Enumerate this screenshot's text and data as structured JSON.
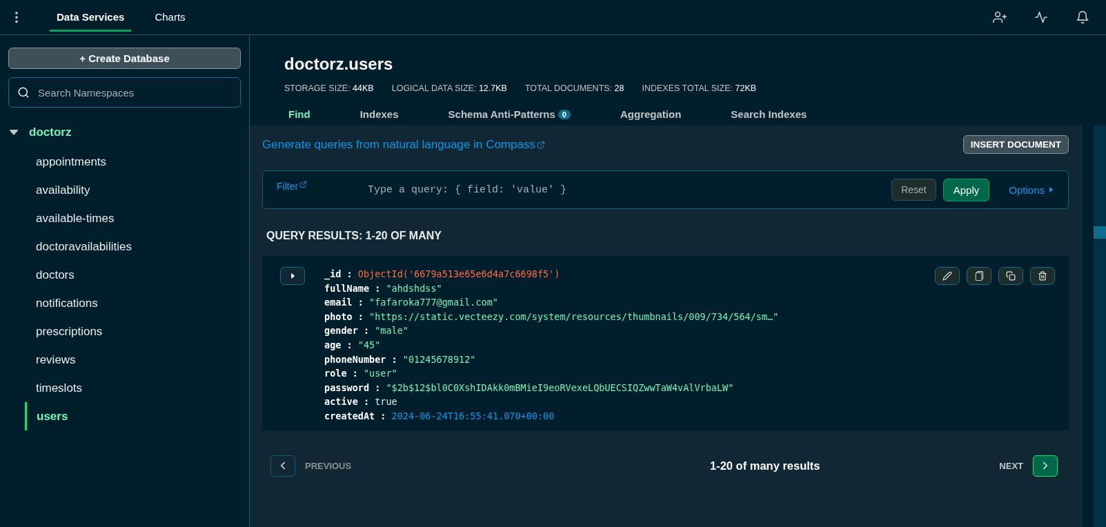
{
  "top_tabs": [
    {
      "label": "Data Services",
      "selected": true
    },
    {
      "label": "Charts",
      "selected": false
    }
  ],
  "sidebar": {
    "create_button": "+ Create Database",
    "search": {
      "placeholder": "Search Namespaces"
    },
    "database": {
      "name": "doctorz",
      "expanded": true,
      "children": [
        {
          "label": "appointments",
          "selected": false
        },
        {
          "label": "availability",
          "selected": false
        },
        {
          "label": "available-times",
          "selected": false
        },
        {
          "label": "doctoravailabilities",
          "selected": false
        },
        {
          "label": "doctors",
          "selected": false
        },
        {
          "label": "notifications",
          "selected": false
        },
        {
          "label": "prescriptions",
          "selected": false
        },
        {
          "label": "reviews",
          "selected": false
        },
        {
          "label": "timeslots",
          "selected": false
        },
        {
          "label": "users",
          "selected": true
        }
      ]
    }
  },
  "collection": {
    "title": "doctorz.users",
    "stats": [
      {
        "label": "STORAGE SIZE:",
        "value": "44KB"
      },
      {
        "label": "LOGICAL DATA SIZE:",
        "value": "12.7KB"
      },
      {
        "label": "TOTAL DOCUMENTS:",
        "value": "28"
      },
      {
        "label": "INDEXES TOTAL SIZE:",
        "value": "72KB"
      }
    ],
    "tabs": [
      {
        "label": "Find",
        "selected": true
      },
      {
        "label": "Indexes",
        "selected": false
      },
      {
        "label": "Schema Anti-Patterns",
        "selected": false,
        "badge": "0"
      },
      {
        "label": "Aggregation",
        "selected": false
      },
      {
        "label": "Search Indexes",
        "selected": false
      }
    ]
  },
  "find": {
    "compass_link": "Generate queries from natural language in Compass",
    "insert_button": "INSERT DOCUMENT",
    "filter": {
      "label": "Filter",
      "placeholder": "Type a query: { field: 'value' }",
      "reset": "Reset",
      "apply": "Apply",
      "options": "Options"
    },
    "results_title": "QUERY RESULTS: 1-20 OF MANY",
    "document": {
      "expanded": false,
      "separator": ":",
      "fields": [
        {
          "key": "_id",
          "value": "ObjectId('6679a513e65e6d4a7c6698f5')",
          "kind": "objectid"
        },
        {
          "key": "fullName",
          "value": "\"ahdshdss\"",
          "kind": "string"
        },
        {
          "key": "email",
          "value": "\"fafaroka777@gmail.com\"",
          "kind": "string"
        },
        {
          "key": "photo",
          "value": "\"https://static.vecteezy.com/system/resources/thumbnails/009/734/564/sm…\"",
          "kind": "string"
        },
        {
          "key": "gender",
          "value": "\"male\"",
          "kind": "string"
        },
        {
          "key": "age",
          "value": "\"45\"",
          "kind": "string"
        },
        {
          "key": "phoneNumber",
          "value": "\"01245678912\"",
          "kind": "string"
        },
        {
          "key": "role",
          "value": "\"user\"",
          "kind": "string"
        },
        {
          "key": "password",
          "value": "\"$2b$12$bl0C0XshIDAkk0mBMieI9eoRVexeLQbUECSIQZwwTaW4vAlVrbaLW\"",
          "kind": "string"
        },
        {
          "key": "active",
          "value": "true",
          "kind": "boolean"
        },
        {
          "key": "createdAt",
          "value": "2024-06-24T16:55:41.070+00:00",
          "kind": "date"
        }
      ]
    },
    "pagination": {
      "previous": "PREVIOUS",
      "summary": "1-20 of many results",
      "next": "NEXT",
      "previous_disabled": true
    }
  }
}
